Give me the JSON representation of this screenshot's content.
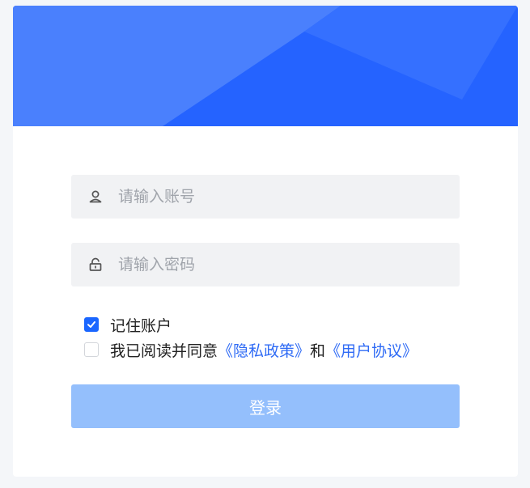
{
  "form": {
    "account_placeholder": "请输入账号",
    "password_placeholder": "请输入密码",
    "account_icon": "user-icon",
    "password_icon": "lock-icon"
  },
  "remember": {
    "label": "记住账户",
    "checked": true
  },
  "agreement": {
    "checked": false,
    "prefix": "我已阅读并同意",
    "privacy_link": "《隐私政策》",
    "connector": "和",
    "terms_link": "《用户协议》"
  },
  "login_button": {
    "label": "登录"
  },
  "colors": {
    "banner_primary": "#2563ff",
    "banner_light": "#4a80fd",
    "checkbox_checked": "#1a66ff",
    "link": "#2f6bf5",
    "button_disabled": "#94bffc"
  }
}
